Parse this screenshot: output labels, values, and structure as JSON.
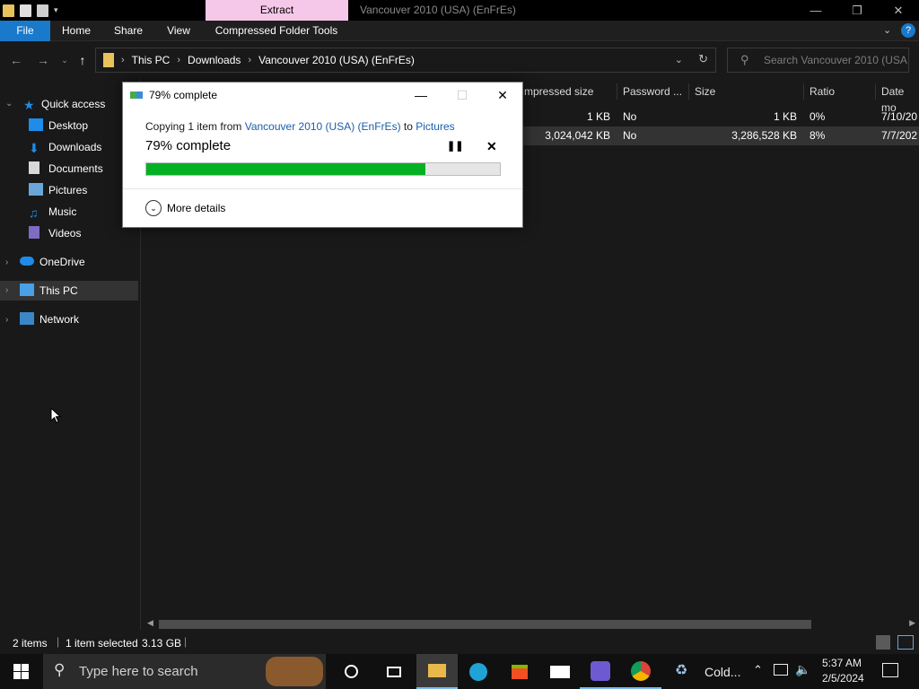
{
  "window": {
    "title": "Vancouver 2010 (USA) (EnFrEs)",
    "context_tab": "Extract"
  },
  "ribbon": {
    "tabs": [
      "File",
      "Home",
      "Share",
      "View",
      "Compressed Folder Tools"
    ]
  },
  "address": {
    "crumbs": [
      "This PC",
      "Downloads",
      "Vancouver 2010 (USA) (EnFrEs)"
    ],
    "search_placeholder": "Search Vancouver 2010 (USA..."
  },
  "nav": {
    "quick_access": "Quick access",
    "items": [
      "Desktop",
      "Downloads",
      "Documents",
      "Pictures",
      "Music",
      "Videos"
    ],
    "onedrive": "OneDrive",
    "thispc": "This PC",
    "network": "Network"
  },
  "columns": [
    "mpressed size",
    "Password ...",
    "Size",
    "Ratio",
    "Date mo"
  ],
  "rows": [
    {
      "compressed": "1 KB",
      "password": "No",
      "size": "1 KB",
      "ratio": "0%",
      "date": "7/10/20"
    },
    {
      "compressed": "3,024,042 KB",
      "password": "No",
      "size": "3,286,528 KB",
      "ratio": "8%",
      "date": "7/7/202"
    }
  ],
  "status": {
    "items": "2 items",
    "selected": "1 item selected",
    "size": "3.13 GB"
  },
  "dialog": {
    "title": "79% complete",
    "copy_prefix": "Copying 1 item from",
    "source": "Vancouver 2010 (USA) (EnFrEs)",
    "to": "to",
    "destination": "Pictures",
    "percent_text": "79% complete",
    "progress": 0.79,
    "more_details": "More details"
  },
  "taskbar": {
    "search_placeholder": "Type here to search",
    "weather": "Cold...",
    "time": "5:37 AM",
    "date": "2/5/2024"
  }
}
